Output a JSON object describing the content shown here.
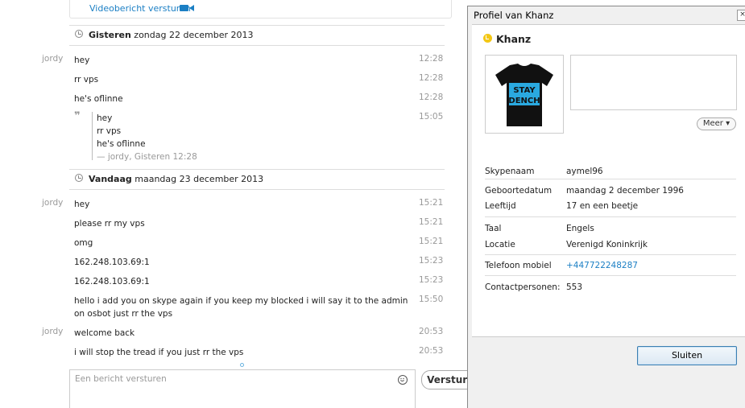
{
  "chat": {
    "video_link": "Videobericht versturen",
    "day1": {
      "bold": "Gisteren",
      "rest": " zondag 22 december 2013"
    },
    "day2": {
      "bold": "Vandaag",
      "rest": " maandag 23 december 2013"
    },
    "messages_day1": [
      {
        "sender": "jordy",
        "text": "hey",
        "time": "12:28"
      },
      {
        "sender": "",
        "text": "rr vps",
        "time": "12:28"
      },
      {
        "sender": "",
        "text": "he's oflinne",
        "time": "12:28"
      }
    ],
    "quote": {
      "lines": [
        "hey",
        "rr vps",
        "he's oflinne"
      ],
      "source": "— jordy, Gisteren 12:28",
      "time": "15:05"
    },
    "messages_day2": [
      {
        "sender": "jordy",
        "text": "hey",
        "time": "15:21"
      },
      {
        "sender": "",
        "text": "please rr my vps",
        "time": "15:21"
      },
      {
        "sender": "",
        "text": "omg",
        "time": "15:21"
      },
      {
        "sender": "",
        "text": "162.248.103.69:1",
        "time": "15:23"
      },
      {
        "sender": "",
        "text": "162.248.103.69:1",
        "time": "15:23"
      },
      {
        "sender": "",
        "text": "hello    i add you on skype again    if you keep my blocked i will say it to the admin  on osbot   just rr the vps",
        "time": "15:50"
      },
      {
        "sender": "jordy",
        "text": "welcome back",
        "time": "20:53"
      },
      {
        "sender": "",
        "text": "i will stop the tread if you just rr the vps",
        "time": "20:53"
      }
    ],
    "composer_placeholder": "Een bericht versturen",
    "send_label": "Versturen"
  },
  "profile": {
    "window_title": "Profiel van Khanz",
    "close_x": "×",
    "name": "Khanz",
    "avatar_text": [
      "STAY",
      "DENCH"
    ],
    "more_label": "Meer ▾",
    "fields": [
      {
        "label": "Skypenaam",
        "value": "aymel96"
      },
      {
        "label": "Geboortedatum",
        "value": "maandag 2 december 1996"
      },
      {
        "label": "Leeftijd",
        "value": "17 en een beetje"
      },
      {
        "label": "Taal",
        "value": "Engels"
      },
      {
        "label": "Locatie",
        "value": "Verenigd Koninkrijk"
      },
      {
        "label": "Telefoon mobiel",
        "value": "+447722248287"
      },
      {
        "label": "Contactpersonen:",
        "value": "553"
      }
    ],
    "close_label": "Sluiten"
  },
  "colors": {
    "link": "#1b7fc4",
    "status": "#f3c715",
    "shirt_text": "#2aa9e0"
  }
}
